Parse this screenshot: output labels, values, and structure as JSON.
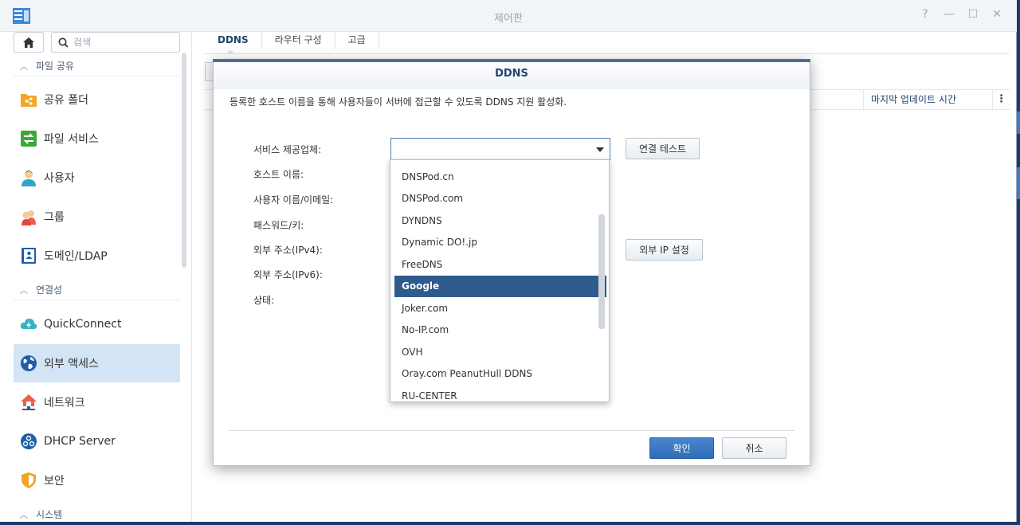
{
  "window": {
    "title": "제어판",
    "controls": [
      "?",
      "—",
      "☐",
      "✕"
    ]
  },
  "sidebar": {
    "search_placeholder": "검색",
    "sections": [
      {
        "label": "파일 공유"
      },
      {
        "label": "연결성"
      },
      {
        "label": "시스템"
      }
    ],
    "items": [
      {
        "label": "공유 폴더",
        "icon": "shared-folder-icon"
      },
      {
        "label": "파일 서비스",
        "icon": "file-services-icon"
      },
      {
        "label": "사용자",
        "icon": "user-icon"
      },
      {
        "label": "그룹",
        "icon": "group-icon"
      },
      {
        "label": "도메인/LDAP",
        "icon": "domain-ldap-icon"
      },
      {
        "label": "QuickConnect",
        "icon": "quickconnect-icon"
      },
      {
        "label": "외부 액세스",
        "icon": "external-access-icon",
        "active": true
      },
      {
        "label": "네트워크",
        "icon": "network-icon"
      },
      {
        "label": "DHCP Server",
        "icon": "dhcp-server-icon"
      },
      {
        "label": "보안",
        "icon": "security-icon"
      }
    ]
  },
  "main": {
    "tabs": [
      {
        "label": "DDNS",
        "active": true
      },
      {
        "label": "라우터 구성"
      },
      {
        "label": "고급"
      }
    ],
    "table": {
      "last_update_header": "마지막 업데이트 시간",
      "menu_glyph": "⋮"
    }
  },
  "dialog": {
    "title": "DDNS",
    "description": "등록한 호스트 이름을 통해 사용자들이 서버에 접근할 수 있도록 DDNS 지원 활성화.",
    "labels": {
      "provider": "서비스 제공업체:",
      "hostname": "호스트 이름:",
      "username": "사용자 이름/이메일:",
      "password": "패스워드/키:",
      "ipv4": "외부 주소(IPv4):",
      "ipv6": "외부 주소(IPv6):",
      "status": "상태:"
    },
    "provider_value": "",
    "buttons": {
      "test_connection": "연결 테스트",
      "external_ip": "외부 IP 설정",
      "ok": "확인",
      "cancel": "취소"
    },
    "dropdown_options": [
      "DNSPod.cn",
      "DNSPod.com",
      "DYNDNS",
      "Dynamic DO!.jp",
      "FreeDNS",
      "Google",
      "Joker.com",
      "No-IP.com",
      "OVH",
      "Oray.com PeanutHull DDNS",
      "RU-CENTER"
    ],
    "highlighted_option": "Google"
  },
  "colors": {
    "accent": "#2e5b8c",
    "primary_button": "#2f6db8",
    "active_nav": "#d3e4f5",
    "title_text": "#23456e"
  }
}
